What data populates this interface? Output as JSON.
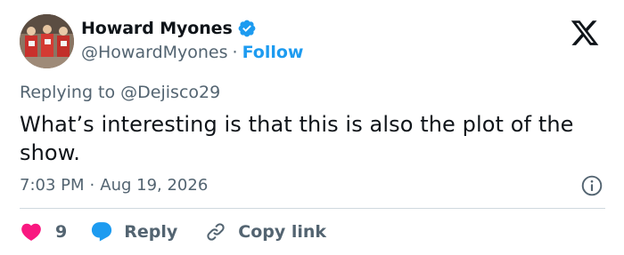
{
  "author": {
    "display_name": "Howard Myones",
    "handle": "@HowardMyones",
    "separator": "·",
    "follow_label": "Follow",
    "avatar_icon": "avatar-photo",
    "verified_icon": "verified-badge-icon"
  },
  "platform": {
    "logo_icon": "x-logo-icon"
  },
  "reply_context": {
    "prefix": "Replying to",
    "mention": "@Dejisco29"
  },
  "tweet": {
    "text": "What’s interesting is that this is also the plot of the show.",
    "time": "7:03 PM",
    "separator": "·",
    "date": "Aug 19, 2026"
  },
  "actions": {
    "like_count": "9",
    "reply_label": "Reply",
    "copy_link_label": "Copy link",
    "like_icon": "heart-icon",
    "reply_icon": "speech-bubble-icon",
    "copy_icon": "link-icon",
    "info_icon": "info-icon"
  },
  "colors": {
    "accent": "#1d9bf0",
    "like": "#f91880",
    "text": "#0f1419",
    "muted": "#536471",
    "divider": "#cfd9de"
  }
}
